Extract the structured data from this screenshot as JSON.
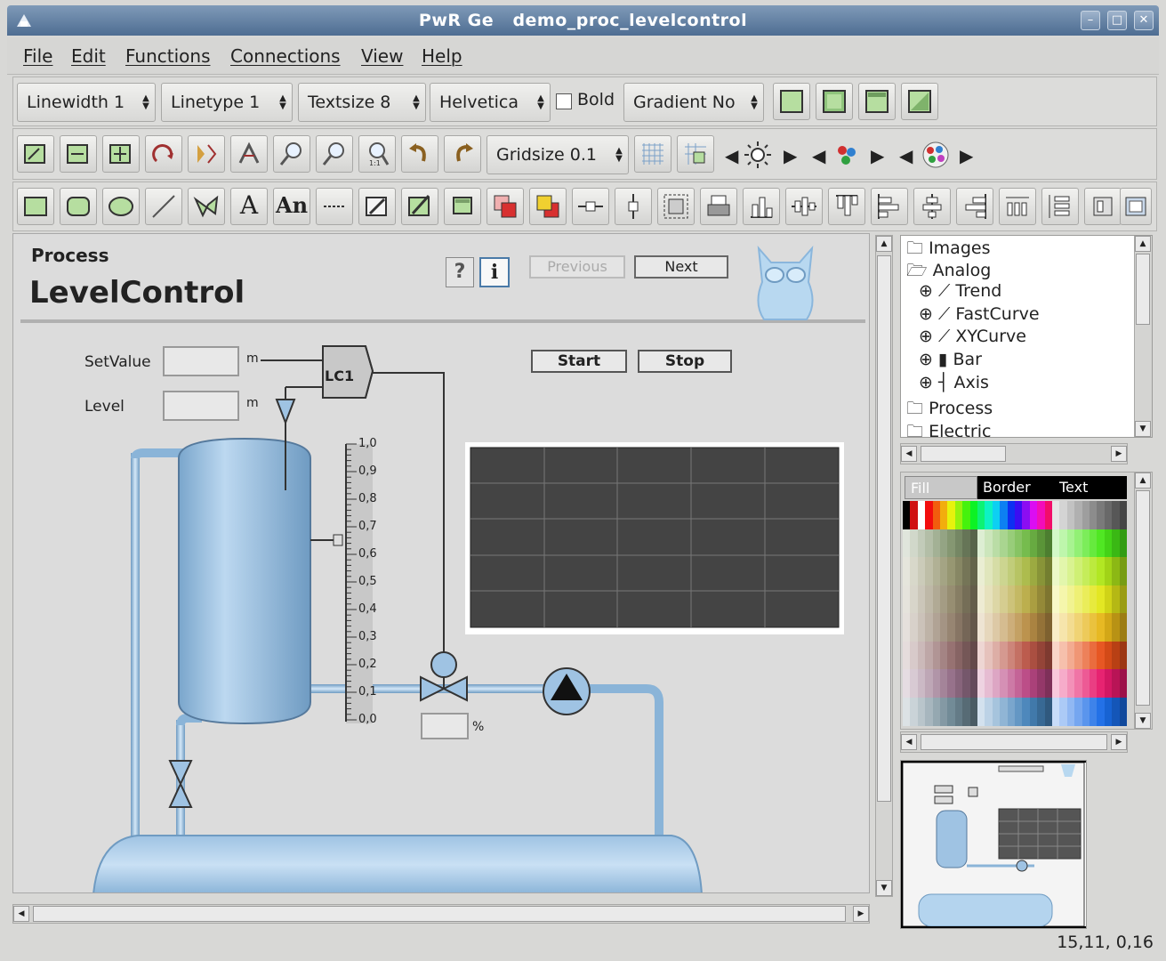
{
  "window": {
    "title": "PwR Ge   demo_proc_levelcontrol"
  },
  "menu": [
    "File",
    "Edit",
    "Functions",
    "Connections",
    "View",
    "Help"
  ],
  "toolbar1": {
    "linewidth": "Linewidth 1",
    "linetype": "Linetype 1",
    "textsize": "Textsize 8",
    "font": "Helvetica",
    "bold_label": "Bold",
    "bold_checked": false,
    "gradient": "Gradient No"
  },
  "toolbar2": {
    "gridsize": "Gridsize 0.1"
  },
  "toolbar3": {
    "text_A": "A",
    "text_An": "An"
  },
  "graph": {
    "section": "Process",
    "title": "LevelControl",
    "help_glyph": "?",
    "info_glyph": "i",
    "previous": "Previous",
    "next": "Next",
    "start": "Start",
    "stop": "Stop",
    "setvalue_label": "SetValue",
    "level_label": "Level",
    "unit_m": "m",
    "unit_percent": "%",
    "controller": "LC1",
    "scale_ticks": [
      "1,0",
      "0,9",
      "0,8",
      "0,7",
      "0,6",
      "0,5",
      "0,4",
      "0,3",
      "0,2",
      "0,1",
      "0,0"
    ]
  },
  "tree": {
    "items": [
      {
        "label": "Images",
        "level": 0,
        "icon": "folder-closed-icon"
      },
      {
        "label": "Analog",
        "level": 0,
        "icon": "folder-open-icon"
      },
      {
        "label": "Trend",
        "level": 1,
        "icon": "curve-icon"
      },
      {
        "label": "FastCurve",
        "level": 1,
        "icon": "curve-icon"
      },
      {
        "label": "XYCurve",
        "level": 1,
        "icon": "curve-icon"
      },
      {
        "label": "Bar",
        "level": 1,
        "icon": "bar-icon"
      },
      {
        "label": "Axis",
        "level": 1,
        "icon": "axis-icon"
      },
      {
        "label": "Process",
        "level": 0,
        "icon": "folder-closed-icon"
      },
      {
        "label": "Electric",
        "level": 0,
        "icon": "folder-closed-icon"
      }
    ]
  },
  "palette": {
    "tabs": [
      "Fill",
      "Border",
      "Text"
    ],
    "selected": "Fill"
  },
  "status": {
    "coords": "15,11, 0,16"
  }
}
